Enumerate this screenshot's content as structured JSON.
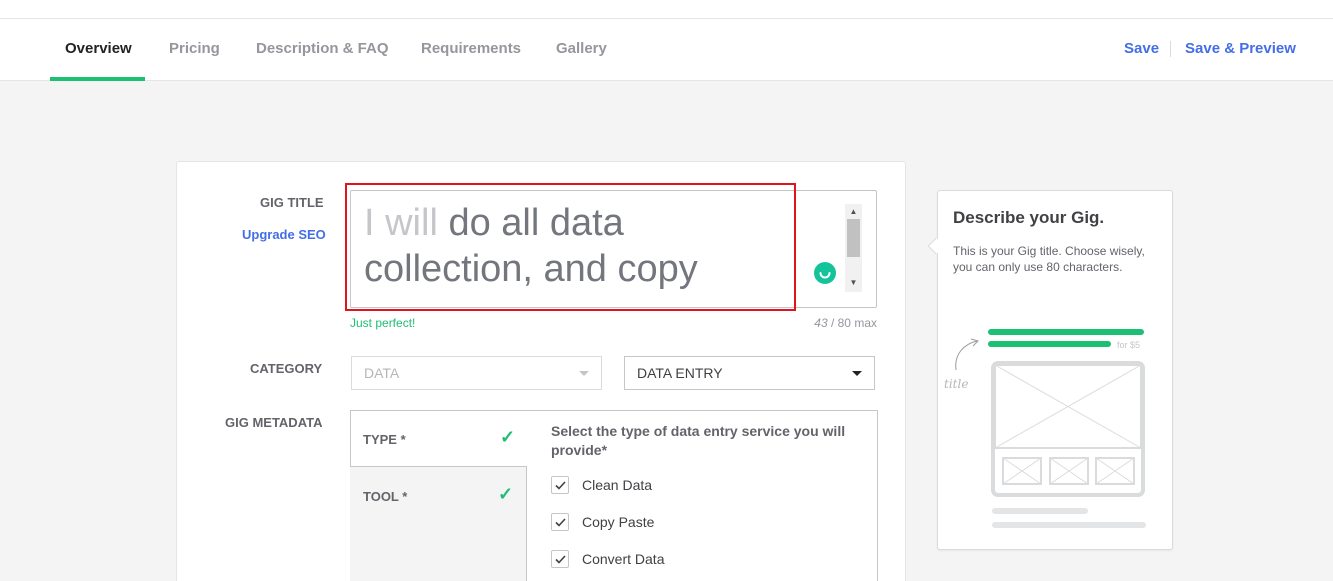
{
  "tabs": [
    {
      "label": "Overview",
      "active": true
    },
    {
      "label": "Pricing",
      "active": false
    },
    {
      "label": "Description & FAQ",
      "active": false
    },
    {
      "label": "Requirements",
      "active": false
    },
    {
      "label": "Gallery",
      "active": false
    }
  ],
  "actions": {
    "save": "Save",
    "save_preview": "Save & Preview"
  },
  "form": {
    "gig_title_label": "GIG TITLE",
    "upgrade_seo": "Upgrade SEO",
    "title_prefix": "I will",
    "title_value": "do all data collection, and copy",
    "title_hint": "Just perfect!",
    "char_count": "43",
    "char_max": "/ 80 max",
    "category_label": "CATEGORY",
    "category_value": "DATA",
    "subcategory_value": "DATA ENTRY",
    "metadata_label": "GIG METADATA",
    "metadata_items": [
      "TYPE *",
      "TOOL *"
    ],
    "metadata_question": "Select the type of data entry service you will provide*",
    "options": [
      {
        "label": "Clean Data",
        "checked": true
      },
      {
        "label": "Copy Paste",
        "checked": true
      },
      {
        "label": "Convert Data",
        "checked": true
      }
    ]
  },
  "sidebar": {
    "title": "Describe your Gig.",
    "description": "This is your Gig title. Choose wisely, you can only use 80 characters.",
    "illustration_label": "title",
    "illustration_price": "for $5"
  },
  "colors": {
    "accent_green": "#1dbf73",
    "link_blue": "#446ee7",
    "highlight_red": "#e0141e"
  }
}
